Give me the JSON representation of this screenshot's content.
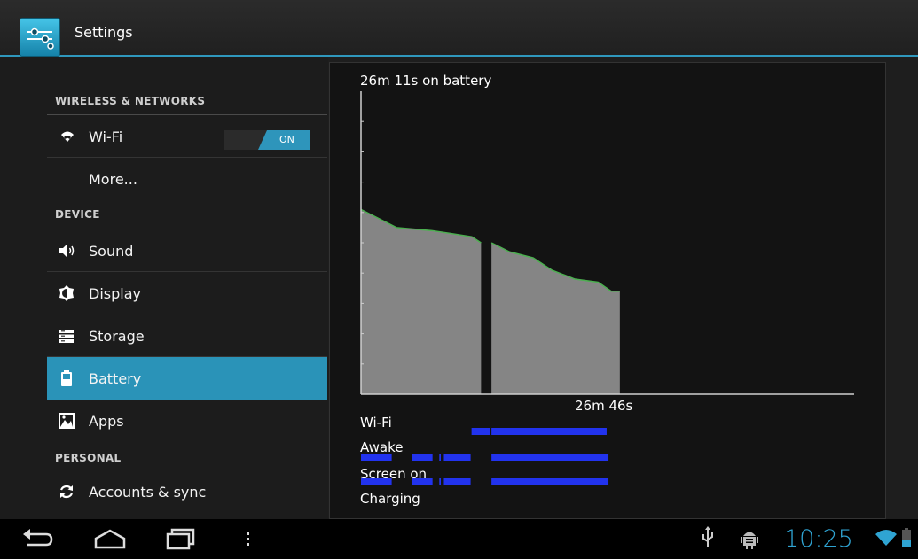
{
  "app": {
    "title": "Settings",
    "icon": "settings-sliders-icon",
    "accent": "#2f98bd"
  },
  "sidebar": {
    "sections": [
      {
        "header": "WIRELESS & NETWORKS"
      },
      {
        "header": "DEVICE"
      },
      {
        "header": "PERSONAL"
      }
    ],
    "items": [
      {
        "label": "Wi-Fi",
        "icon": "wifi-icon",
        "toggle": "ON"
      },
      {
        "label": "More...",
        "icon": ""
      },
      {
        "label": "Sound",
        "icon": "speaker-icon"
      },
      {
        "label": "Display",
        "icon": "display-brightness-icon"
      },
      {
        "label": "Storage",
        "icon": "storage-icon"
      },
      {
        "label": "Battery",
        "icon": "battery-icon",
        "selected": true
      },
      {
        "label": "Apps",
        "icon": "apps-icon"
      },
      {
        "label": "Accounts & sync",
        "icon": "sync-icon"
      }
    ],
    "selected_color": "#2a93b8"
  },
  "battery": {
    "title": "26m 11s on battery",
    "duration": "26m 46s",
    "timelines": [
      {
        "label": "Wi-Fi"
      },
      {
        "label": "Awake"
      },
      {
        "label": "Screen on"
      },
      {
        "label": "Charging"
      }
    ],
    "bar_color": "#2233ee"
  },
  "chart_data": {
    "type": "area",
    "title": "26m 11s on battery",
    "xlabel": "26m 46s",
    "x_unit": "s",
    "xlim": [
      0,
      1606
    ],
    "ylim": [
      0,
      100
    ],
    "grid": false,
    "series": [
      {
        "values": [
          [
            0,
            61
          ],
          [
            116,
            55
          ],
          [
            231,
            54
          ],
          [
            361,
            52
          ],
          [
            391,
            50
          ]
        ]
      },
      {
        "values": [
          [
            425,
            50
          ],
          [
            484,
            47
          ],
          [
            561,
            45
          ],
          [
            621,
            41
          ],
          [
            697,
            38
          ],
          [
            772,
            37
          ],
          [
            815,
            34
          ],
          [
            843,
            34
          ]
        ]
      }
    ],
    "gap": [
      391,
      425
    ],
    "timelines": {
      "Wi-Fi": [
        [
          360,
          420
        ],
        [
          425,
          800
        ]
      ],
      "Awake": [
        [
          0,
          100
        ],
        [
          165,
          233
        ],
        [
          255,
          260
        ],
        [
          270,
          357
        ],
        [
          425,
          806
        ]
      ],
      "Screen on": [
        [
          0,
          100
        ],
        [
          165,
          233
        ],
        [
          255,
          260
        ],
        [
          270,
          357
        ],
        [
          425,
          806
        ]
      ],
      "Charging": []
    },
    "area_color": "#858585",
    "line_color": "#4caf50"
  },
  "statusbar": {
    "time": "10:25",
    "time_color": "#2fa4d3",
    "icons": [
      "usb-icon",
      "debug-android-icon",
      "wifi-signal-icon",
      "battery-low-icon"
    ]
  },
  "navbar": {
    "buttons": [
      "back-icon",
      "home-icon",
      "recent-apps-icon",
      "menu-icon"
    ]
  }
}
